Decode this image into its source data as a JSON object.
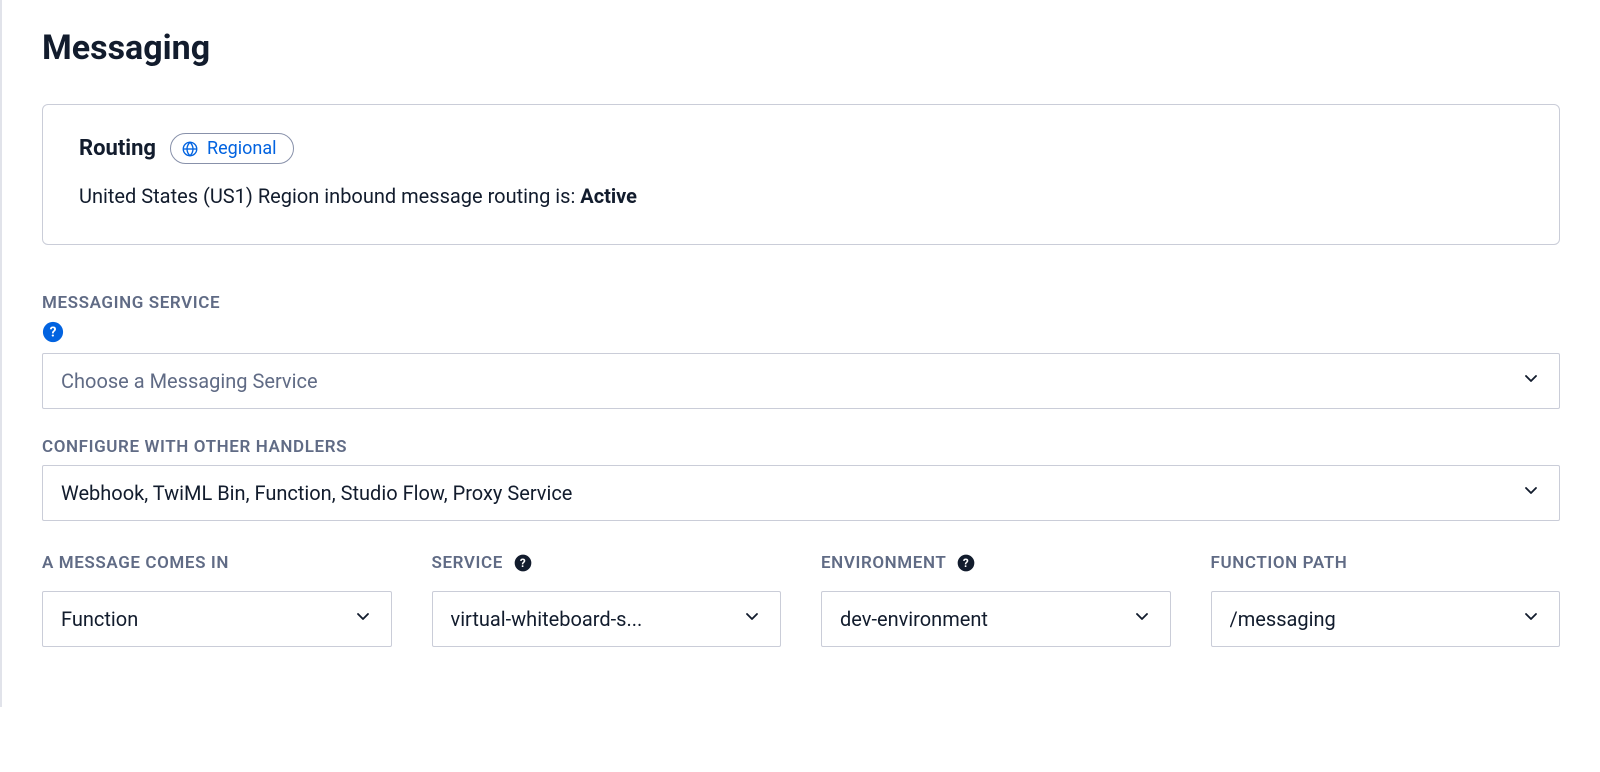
{
  "header": {
    "title": "Messaging"
  },
  "routing": {
    "title": "Routing",
    "badge_label": "Regional",
    "status_prefix": "United States (US1) Region inbound message routing is: ",
    "status_value": "Active"
  },
  "messaging_service": {
    "label": "MESSAGING SERVICE",
    "placeholder": "Choose a Messaging Service"
  },
  "other_handlers": {
    "label": "CONFIGURE WITH OTHER HANDLERS",
    "value": "Webhook, TwiML Bin, Function, Studio Flow, Proxy Service"
  },
  "columns": {
    "message_comes_in": {
      "label": "A MESSAGE COMES IN",
      "value": "Function"
    },
    "service": {
      "label": "SERVICE",
      "value": "virtual-whiteboard-s..."
    },
    "environment": {
      "label": "ENVIRONMENT",
      "value": "dev-environment"
    },
    "function_path": {
      "label": "FUNCTION PATH",
      "value": "/messaging"
    }
  }
}
